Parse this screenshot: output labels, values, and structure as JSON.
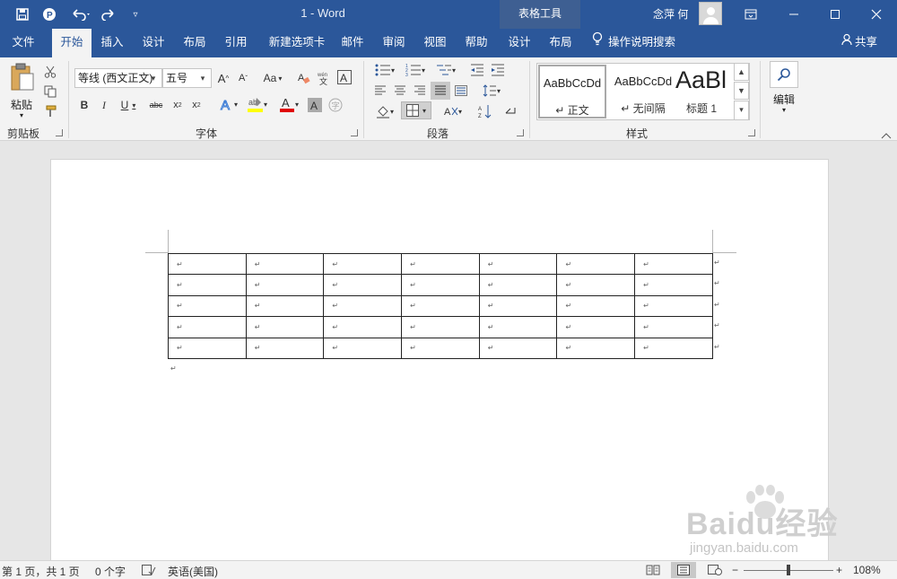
{
  "window": {
    "title": "1  -  Word",
    "context_tab_header": "表格工具",
    "user_name": "念萍 何"
  },
  "tabs": [
    "文件",
    "开始",
    "插入",
    "设计",
    "布局",
    "引用",
    "新建选项卡",
    "邮件",
    "审阅",
    "视图",
    "帮助",
    "设计",
    "布局"
  ],
  "active_tab_index": 1,
  "tell_me": "操作说明搜索",
  "share": "共享",
  "clipboard": {
    "paste_label": "粘贴",
    "group_label": "剪贴板"
  },
  "font": {
    "font_name": "等线 (西文正文)",
    "font_size": "五号",
    "case_button": "Aa",
    "group_label": "字体"
  },
  "paragraph": {
    "group_label": "段落"
  },
  "styles": {
    "items": [
      {
        "sample": "AaBbCcDd",
        "name": "↵ 正文"
      },
      {
        "sample": "AaBbCcDd",
        "name": "↵ 无间隔"
      },
      {
        "sample": "AaBl",
        "name": "标题 1"
      }
    ],
    "group_label": "样式"
  },
  "editing": {
    "label": "编辑"
  },
  "document": {
    "table": {
      "rows": 5,
      "cols": 7,
      "cell_mark": "↵"
    },
    "paragraph_mark": "↵"
  },
  "status": {
    "page": "第 1 页，共 1 页",
    "words": "0 个字",
    "language": "英语(美国)",
    "zoom": "108%",
    "zoom_minus": "−",
    "zoom_plus": "+"
  },
  "watermark": {
    "main": "Baidu经验",
    "sub": "jingyan.baidu.com"
  },
  "colors": {
    "titlebar": "#2b579a",
    "context_header": "#3e5f92",
    "ribbon": "#f3f3f3",
    "font_color_red": "#e00000",
    "highlight_yellow": "#ffff00"
  }
}
